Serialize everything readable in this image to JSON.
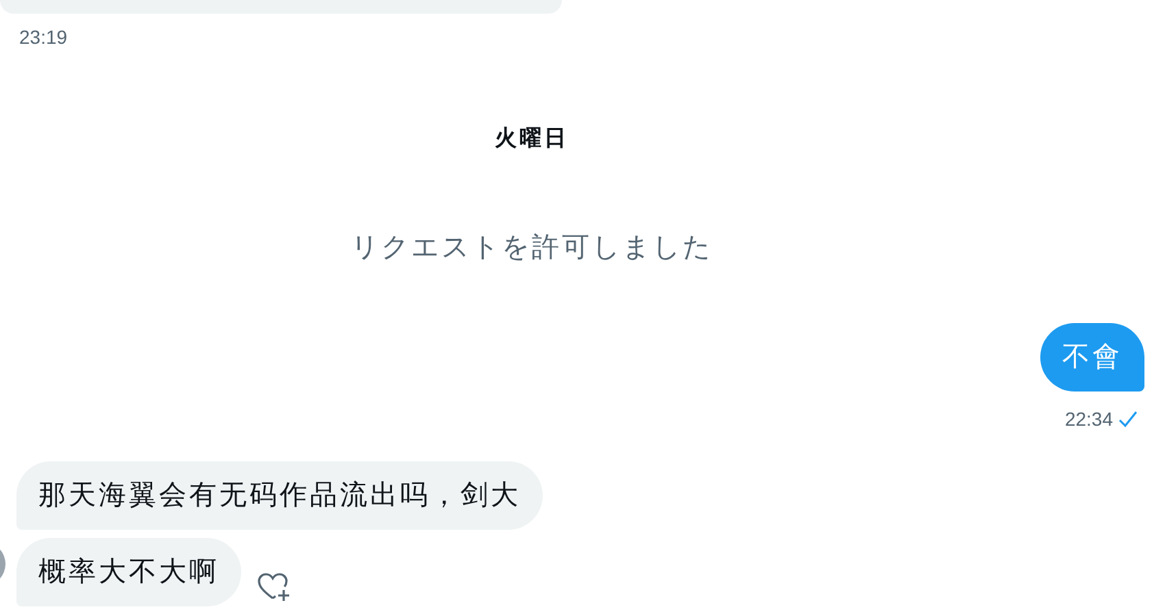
{
  "messages": [
    {
      "kind": "time",
      "sent": false,
      "text": "23:19"
    },
    {
      "kind": "day",
      "text": "火曜日"
    },
    {
      "kind": "notice",
      "text": "リクエストを許可しました"
    },
    {
      "kind": "bubble",
      "sent": true,
      "text": "不會"
    },
    {
      "kind": "time",
      "sent": true,
      "text": "22:34",
      "read": true
    },
    {
      "kind": "bubble",
      "sent": false,
      "text": "那天海翼会有无码作品流出吗，剑大"
    },
    {
      "kind": "bubble",
      "sent": false,
      "text": "概率大不大啊",
      "reaction_button": true
    }
  ]
}
